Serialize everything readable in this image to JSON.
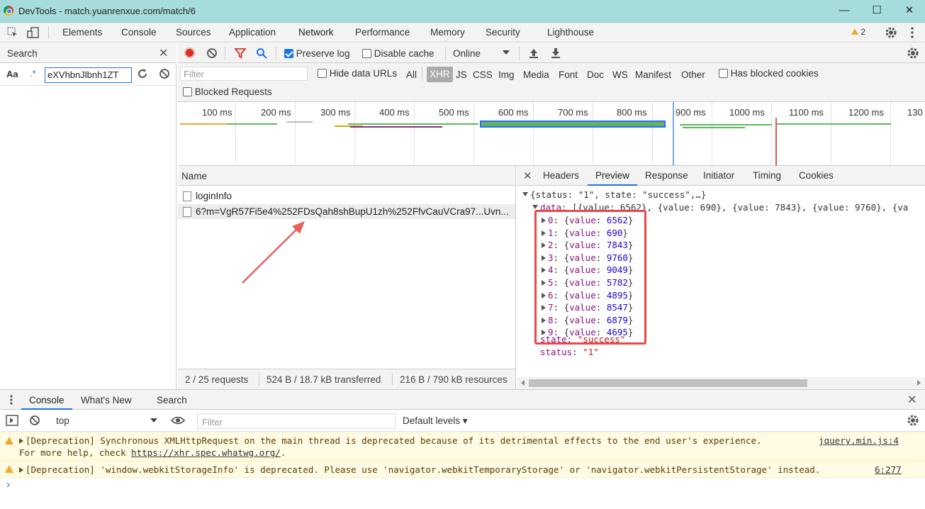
{
  "window": {
    "title": "DevTools - match.yuanrenxue.com/match/6",
    "minimize": "—",
    "maximize": "☐",
    "close": "✕"
  },
  "panel_tabs": [
    "Elements",
    "Console",
    "Sources",
    "Application",
    "Network",
    "Performance",
    "Memory",
    "Security",
    "Lighthouse"
  ],
  "active_panel": "Network",
  "warnings_badge": "2",
  "search": {
    "title": "Search",
    "case_label": "Aa",
    "regex_label": ".*",
    "query": "eXVhbnJlbnh1ZT"
  },
  "toolbar": {
    "preserve_log": "Preserve log",
    "disable_cache": "Disable cache",
    "throttle": "Online"
  },
  "filter": {
    "placeholder": "Filter",
    "hide_data_urls": "Hide data URLs",
    "types": [
      "All",
      "XHR",
      "JS",
      "CSS",
      "Img",
      "Media",
      "Font",
      "Doc",
      "WS",
      "Manifest",
      "Other"
    ],
    "active_type": "XHR",
    "has_blocked_cookies": "Has blocked cookies",
    "blocked_requests": "Blocked Requests"
  },
  "timeline_ticks": [
    "100 ms",
    "200 ms",
    "300 ms",
    "400 ms",
    "500 ms",
    "600 ms",
    "700 ms",
    "800 ms",
    "900 ms",
    "1000 ms",
    "1100 ms",
    "1200 ms",
    "130"
  ],
  "requests": {
    "header": "Name",
    "items": [
      "loginInfo",
      "6?m=VgR57Fi5e4%252FDsQah8shBupU1zh%252FfvCauVCra97...Uvn..."
    ]
  },
  "network_status": {
    "requests": "2 / 25 requests",
    "transferred": "524 B / 18.7 kB transferred",
    "resources": "216 B / 790 kB resources"
  },
  "detail_tabs": [
    "Headers",
    "Preview",
    "Response",
    "Initiator",
    "Timing",
    "Cookies"
  ],
  "active_detail_tab": "Preview",
  "preview": {
    "root": "{status: \"1\", state: \"success\",…}",
    "data_key": "data",
    "data_summary": "[{value: 6562}, {value: 690}, {value: 7843}, {value: 9760}, {va",
    "items": [
      {
        "index": "0",
        "value": "6562"
      },
      {
        "index": "1",
        "value": "690"
      },
      {
        "index": "2",
        "value": "7843"
      },
      {
        "index": "3",
        "value": "9760"
      },
      {
        "index": "4",
        "value": "9049"
      },
      {
        "index": "5",
        "value": "5782"
      },
      {
        "index": "6",
        "value": "4895"
      },
      {
        "index": "7",
        "value": "8547"
      },
      {
        "index": "8",
        "value": "6879"
      },
      {
        "index": "9",
        "value": "4695"
      }
    ],
    "state_key": "state",
    "state_value": "\"success\"",
    "status_key": "status",
    "status_value": "\"1\""
  },
  "drawer_tabs": [
    "Console",
    "What's New",
    "Search"
  ],
  "console": {
    "context": "top",
    "filter_placeholder": "Filter",
    "levels": "Default levels ▾",
    "messages": [
      {
        "text": "[Deprecation] Synchronous XMLHttpRequest on the main thread is deprecated because of its detrimental effects to the end user's experience.",
        "text2_prefix": "For more help, check ",
        "link": "https://xhr.spec.whatwg.org/",
        "text2_suffix": ".",
        "source": "jquery.min.js:4"
      },
      {
        "text": "[Deprecation] 'window.webkitStorageInfo' is deprecated. Please use 'navigator.webkitTemporaryStorage' or 'navigator.webkitPersistentStorage' instead.",
        "source": "6:277"
      }
    ],
    "prompt": "›"
  },
  "colors": {
    "accent": "#1a73e8",
    "highlight_box": "#e64a4a",
    "arrow": "#e8605a",
    "titlebar": "#a6dcdc"
  }
}
